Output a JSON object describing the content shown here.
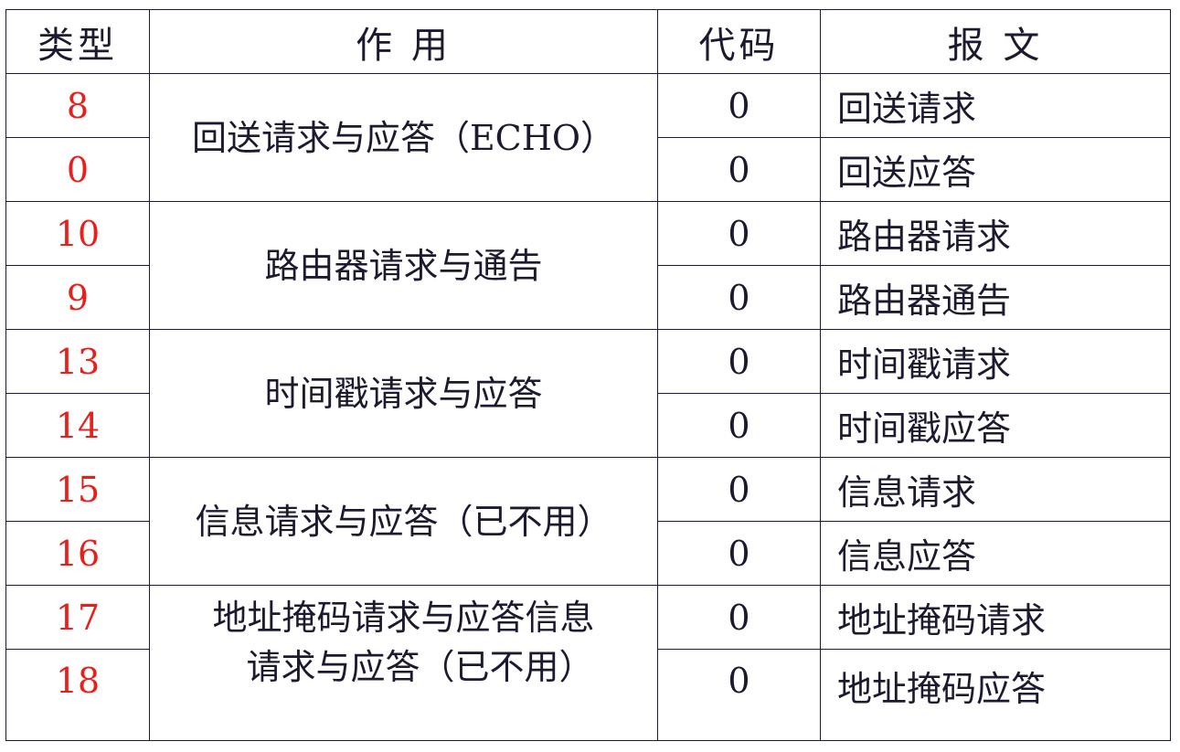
{
  "colors": {
    "type_value": "#e8201c",
    "text": "#1c1a2e",
    "border": "#1c1a2e"
  },
  "headers": {
    "type": "类型",
    "function": "作 用",
    "code": "代码",
    "message": "报 文"
  },
  "groups": [
    {
      "function_lines": [
        "回送请求与应答（ECHO）"
      ],
      "rows": [
        {
          "type": "8",
          "code": "0",
          "message": "回送请求"
        },
        {
          "type": "0",
          "code": "0",
          "message": "回送应答"
        }
      ]
    },
    {
      "function_lines": [
        "路由器请求与通告"
      ],
      "rows": [
        {
          "type": "10",
          "code": "0",
          "message": "路由器请求"
        },
        {
          "type": "9",
          "code": "0",
          "message": "路由器通告"
        }
      ]
    },
    {
      "function_lines": [
        "时间戳请求与应答"
      ],
      "rows": [
        {
          "type": "13",
          "code": "0",
          "message": "时间戳请求"
        },
        {
          "type": "14",
          "code": "0",
          "message": "时间戳应答"
        }
      ]
    },
    {
      "function_lines": [
        "信息请求与应答（已不用）"
      ],
      "rows": [
        {
          "type": "15",
          "code": "0",
          "message": "信息请求"
        },
        {
          "type": "16",
          "code": "0",
          "message": "信息应答"
        }
      ]
    },
    {
      "function_lines": [
        "地址掩码请求与应答信息",
        "请求与应答（已不用）"
      ],
      "rows": [
        {
          "type": "17",
          "code": "0",
          "message": "地址掩码请求"
        },
        {
          "type": "18",
          "code": "0",
          "message": "地址掩码应答"
        }
      ]
    }
  ]
}
